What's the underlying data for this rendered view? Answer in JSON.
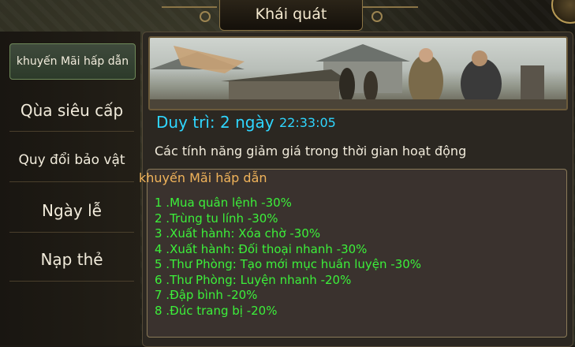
{
  "header": {
    "title": "Khái quát"
  },
  "menu": {
    "items": [
      {
        "label": "khuyến Mãi hấp dẫn",
        "active": true
      },
      {
        "label": "Qùa siêu cấp",
        "active": false
      },
      {
        "label": "Quy đổi bảo vật",
        "active": false
      },
      {
        "label": "Ngày lễ",
        "active": false
      },
      {
        "label": "Nạp thẻ",
        "active": false
      }
    ]
  },
  "event": {
    "duration_label": "Duy trì: 2 ngày",
    "timer": "22:33:05",
    "description": "Các tính năng giảm giá trong thời gian hoạt động"
  },
  "promotions": {
    "title": "khuyến Mãi hấp dẫn",
    "items": [
      "1 .Mua quân lệnh -30%",
      "2 .Trùng tu lính -30%",
      "3 .Xuất hành: Xóa chờ -30%",
      "4 .Xuất hành: Đối thoại nhanh -30%",
      "5 .Thư Phòng: Tạo mới mục huấn luyện -30%",
      "6 .Thư Phòng: Luyện nhanh -20%",
      "7 .Đập bình -20%",
      "8 .Đúc trang bị -20%"
    ]
  },
  "colors": {
    "accent_cyan": "#2fd6ff",
    "promo_green": "#3cf03a",
    "promo_title_orange": "#f0b35a"
  }
}
